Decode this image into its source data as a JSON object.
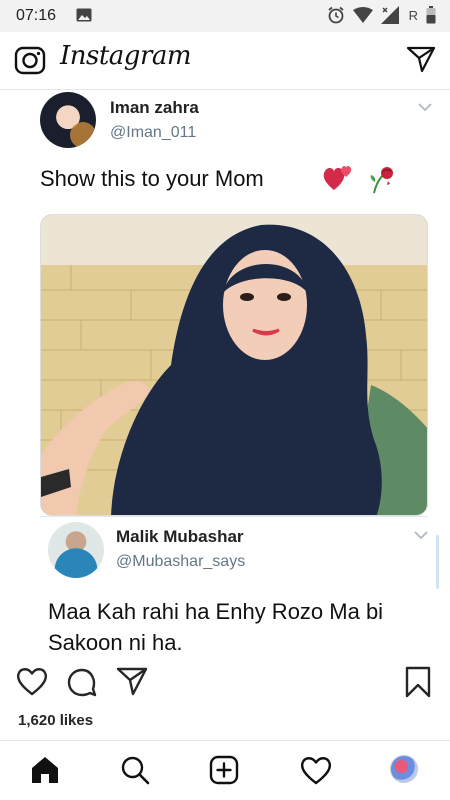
{
  "status_bar": {
    "time": "07:16",
    "carrier_label": "R"
  },
  "app": {
    "logo": "Instagram"
  },
  "post": {
    "author_name": "Iman zahra",
    "author_handle": "@Iman_011",
    "text": "Show this to your Mom",
    "emojis": [
      "two-hearts-icon",
      "wilted-rose-icon"
    ],
    "quote": {
      "author_name": "Malik Mubashar",
      "author_handle": "@Mubashar_says",
      "text": "Maa Kah rahi ha Enhy Rozo Ma bi Sakoon ni ha."
    },
    "likes": "1,620 likes"
  },
  "icons": {
    "top": [
      "camera-icon",
      "direct-message-icon"
    ],
    "actions": [
      "heart-icon",
      "comment-icon",
      "share-icon",
      "bookmark-icon"
    ],
    "nav": [
      "home-icon",
      "search-icon",
      "add-post-icon",
      "activity-heart-icon",
      "profile-avatar"
    ]
  },
  "colors": {
    "handle": "#657786",
    "text": "#111111",
    "icon": "#262626"
  }
}
